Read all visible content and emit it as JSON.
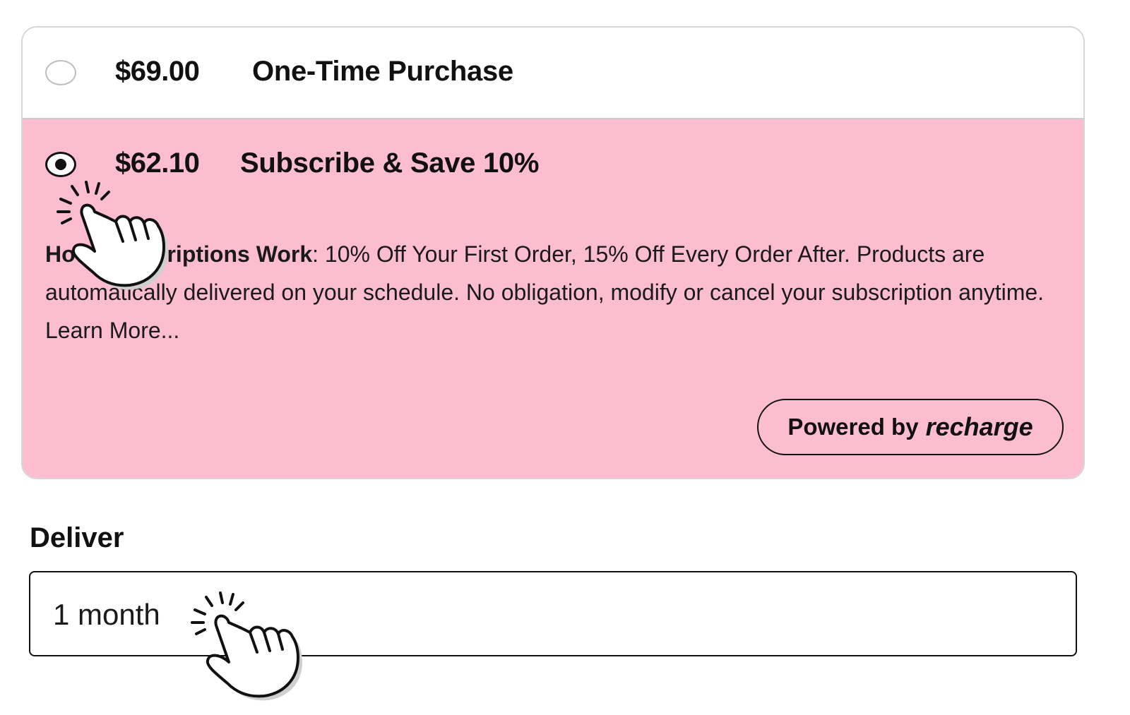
{
  "purchase_options": {
    "one_time": {
      "price": "$69.00",
      "title": "One-Time Purchase",
      "selected": false
    },
    "subscribe": {
      "price": "$62.10",
      "title": "Subscribe & Save 10%",
      "selected": true,
      "description_label": "How Subscriptions Work",
      "description_text": ": 10% Off Your First Order, 15% Off Every Order After. Products are automatically delivered on your schedule. No obligation, modify or cancel your subscription anytime.",
      "learn_more": "Learn More...",
      "powered_by": "Powered by",
      "powered_brand": "recharge"
    }
  },
  "deliver": {
    "label": "Deliver",
    "selected_value": "1 month"
  },
  "colors": {
    "subscribe_background": "#fdbdd0",
    "text": "#111111"
  },
  "icons": [
    "hand-pointer-click-icon"
  ]
}
